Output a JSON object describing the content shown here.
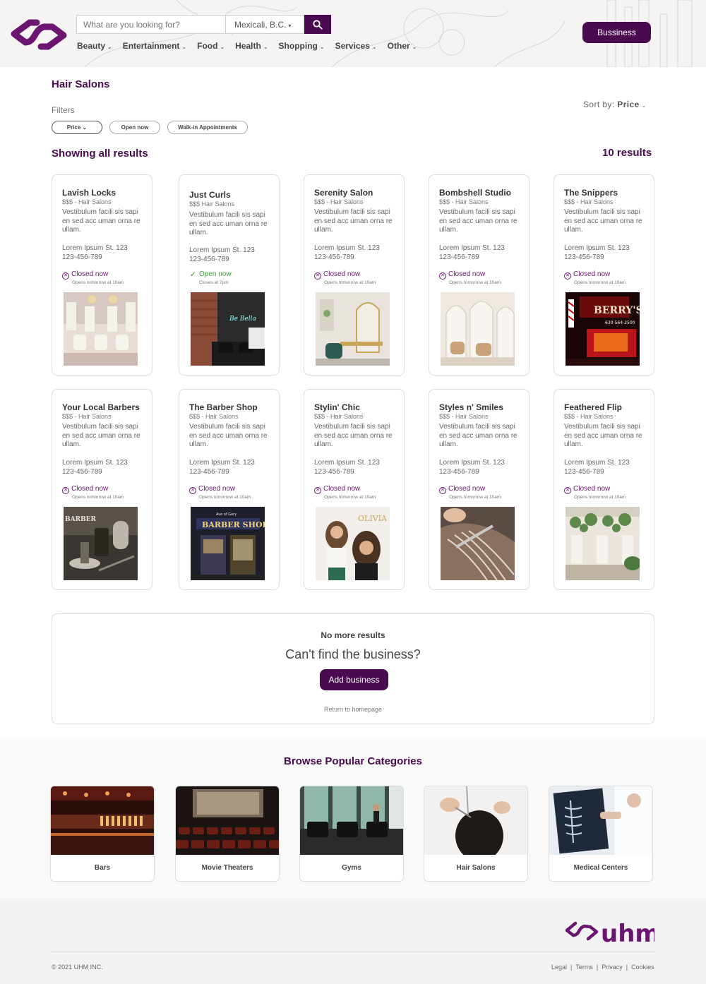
{
  "header": {
    "search_placeholder": "What are you looking for?",
    "location": "Mexicali, B.C.",
    "business_button": "Bussiness",
    "nav": [
      "Beauty",
      "Entertainment",
      "Food",
      "Health",
      "Shopping",
      "Services",
      "Other"
    ]
  },
  "page": {
    "title": "Hair Salons",
    "filters_label": "Filters",
    "filters": [
      "Price",
      "Open now",
      "Walk-in Appointments"
    ],
    "sort_label": "Sort by:",
    "sort_value": "Price",
    "showing": "Showing all results",
    "result_count": "10 results"
  },
  "cards": [
    {
      "name": "Lavish Locks",
      "category": "$$$ - Hair Salons",
      "desc": "Vestibulum facili sis sapi en sed acc uman orna re ullam.",
      "street": "Lorem Ipsum St. 123",
      "phone": "123-456-789",
      "status": "Closed now",
      "open": false,
      "sub": "Opens tomorrow at 10am"
    },
    {
      "name": "Just Curls",
      "category": "$$$  Hair Salons",
      "desc": "Vestibulum facili sis sapi en sed acc uman orna re ullam.",
      "street": "Lorem Ipsum St. 123",
      "phone": "123-456-789",
      "status": "Open now",
      "open": true,
      "sub": "Closes at 7pm"
    },
    {
      "name": "Serenity Salon",
      "category": "$$$ - Hair Salons",
      "desc": "Vestibulum facili sis sapi en sed acc uman orna re ullam.",
      "street": "Lorem Ipsum St. 123",
      "phone": "123-456-789",
      "status": "Closed now",
      "open": false,
      "sub": "Opens tomorrow at 10am"
    },
    {
      "name": "Bombshell Studio",
      "category": "$$$ - Hair Salons",
      "desc": "Vestibulum facili sis sapi en sed acc uman orna re ullam.",
      "street": "Lorem Ipsum St. 123",
      "phone": "123-456-789",
      "status": "Closed now",
      "open": false,
      "sub": "Opens tomorrow at 10am"
    },
    {
      "name": "The Snippers",
      "category": "$$$ - Hair Salons",
      "desc": "Vestibulum facili sis sapi en sed acc uman orna re ullam.",
      "street": "Lorem Ipsum St. 123",
      "phone": "123-456-789",
      "status": "Closed now",
      "open": false,
      "sub": "Opens tomorrow at 10am"
    },
    {
      "name": "Your Local Barbers",
      "category": "$$$ - Hair Salons",
      "desc": "Vestibulum facili sis sapi en sed acc uman orna re ullam.",
      "street": "Lorem Ipsum St. 123",
      "phone": "123-456-789",
      "status": "Closed now",
      "open": false,
      "sub": "Opens tomorrow at 10am"
    },
    {
      "name": "The Barber Shop",
      "category": "$$$ - Hair Salons",
      "desc": "Vestibulum facili sis sapi en sed acc uman orna re ullam.",
      "street": "Lorem Ipsum St. 123",
      "phone": "123-456-789",
      "status": "Closed now",
      "open": false,
      "sub": "Opens tomorrow at 10am"
    },
    {
      "name": "Stylin' Chic",
      "category": "$$$ - Hair Salons",
      "desc": "Vestibulum facili sis sapi en sed acc uman orna re ullam.",
      "street": "Lorem Ipsum St. 123",
      "phone": "123-456-789",
      "status": "Closed now",
      "open": false,
      "sub": "Opens tomorrow at 10am"
    },
    {
      "name": "Styles n' Smiles",
      "category": "$$$ - Hair Salons",
      "desc": "Vestibulum facili sis sapi en sed acc uman orna re ullam.",
      "street": "Lorem Ipsum St. 123",
      "phone": "123-456-789",
      "status": "Closed now",
      "open": false,
      "sub": "Opens tomorrow at 10am"
    },
    {
      "name": "Feathered Flip",
      "category": "$$$ - Hair Salons",
      "desc": "Vestibulum facili sis sapi en sed acc uman orna re ullam.",
      "street": "Lorem Ipsum St. 123",
      "phone": "123-456-789",
      "status": "Closed now",
      "open": false,
      "sub": "Opens tomorrow at 10am"
    }
  ],
  "photo_signs": {
    "curls": "Be Bella",
    "snippers": "BERRY'S",
    "snippers_phone": "630-564-2500",
    "barbers": "BARBER",
    "barber_shop": "BARBER SHOP",
    "barber_shop_top": "Ave of Gary",
    "chic": "OLIVIA"
  },
  "nomore": {
    "title": "No more results",
    "subtitle": "Can't find the business?",
    "button": "Add business",
    "return_link": "Return to homepage"
  },
  "categories": {
    "title": "Browse Popular Categories",
    "items": [
      "Bars",
      "Movie Theaters",
      "Gyms",
      "Hair Salons",
      "Medical Centers"
    ]
  },
  "footer": {
    "logo_text": "uhm",
    "copyright": "© 2021 UHM INC.",
    "links": [
      "Legal",
      "Terms",
      "Privacy",
      "Cookies"
    ]
  },
  "colors": {
    "brand": "#4a0a4f",
    "closed": "#6b1570",
    "open": "#3aa43a"
  }
}
